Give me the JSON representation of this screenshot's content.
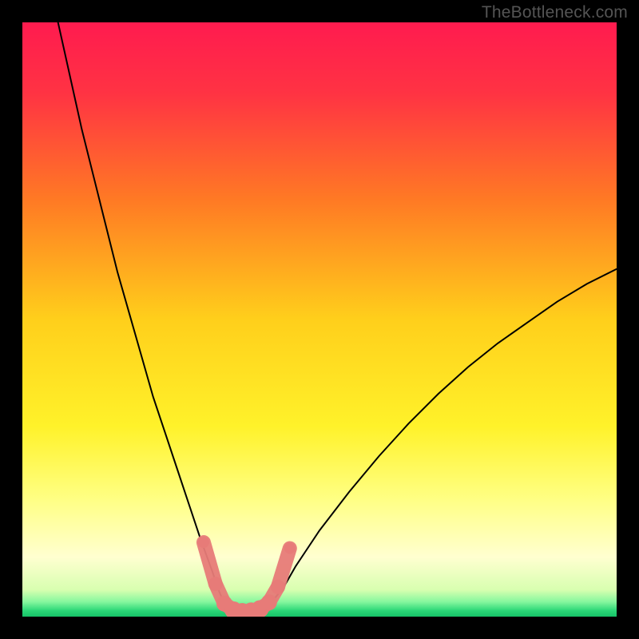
{
  "watermark": "TheBottleneck.com",
  "colors": {
    "frame": "#000000",
    "curve": "#000000",
    "marker_fill": "#e77b78",
    "marker_stroke": "#d76b68"
  },
  "chart_data": {
    "type": "line",
    "title": "",
    "xlabel": "",
    "ylabel": "",
    "xlim": [
      0,
      100
    ],
    "ylim": [
      0,
      100
    ],
    "background_gradient": [
      {
        "pos": 0.0,
        "color": "#ff1b4f"
      },
      {
        "pos": 0.12,
        "color": "#ff3343"
      },
      {
        "pos": 0.3,
        "color": "#ff7a24"
      },
      {
        "pos": 0.5,
        "color": "#ffcf1b"
      },
      {
        "pos": 0.68,
        "color": "#fff22a"
      },
      {
        "pos": 0.8,
        "color": "#ffff82"
      },
      {
        "pos": 0.9,
        "color": "#ffffd0"
      },
      {
        "pos": 0.955,
        "color": "#d8ffb0"
      },
      {
        "pos": 0.975,
        "color": "#86f79e"
      },
      {
        "pos": 0.99,
        "color": "#2bd777"
      },
      {
        "pos": 1.0,
        "color": "#16c268"
      }
    ],
    "series": [
      {
        "name": "left-curve",
        "x": [
          6,
          8,
          10,
          12,
          14,
          16,
          18,
          20,
          22,
          24,
          26,
          28,
          30,
          32,
          33,
          34
        ],
        "y": [
          100,
          91,
          82,
          74,
          66,
          58,
          51,
          44,
          37,
          31,
          25,
          19,
          13,
          7.5,
          4.5,
          2.2
        ]
      },
      {
        "name": "right-curve",
        "x": [
          42,
          44,
          46,
          50,
          55,
          60,
          65,
          70,
          75,
          80,
          85,
          90,
          95,
          100
        ],
        "y": [
          2.5,
          5,
          8.5,
          14.5,
          21,
          27,
          32.5,
          37.5,
          42,
          46,
          49.5,
          53,
          56,
          58.5
        ]
      }
    ],
    "highlight_band": {
      "name": "valley-markers",
      "x": [
        30.5,
        32.5,
        34,
        35.5,
        37,
        38.5,
        40,
        41.5,
        43,
        45
      ],
      "y": [
        12.5,
        5.5,
        2.2,
        1.1,
        0.8,
        0.9,
        1.3,
        2.4,
        5.0,
        11.5
      ],
      "r": [
        7,
        9,
        10,
        11,
        11,
        11,
        11,
        10,
        9,
        7
      ]
    }
  }
}
